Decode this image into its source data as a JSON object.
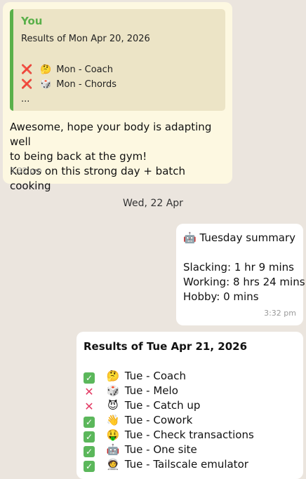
{
  "incoming": {
    "quote": {
      "author": "You",
      "title": "Results of Mon Apr 20, 2026",
      "items": [
        {
          "mark": "❌",
          "emoji": "🤔",
          "text": "Mon - Coach"
        },
        {
          "mark": "❌",
          "emoji": "🎲",
          "text": "Mon - Chords"
        }
      ],
      "more": "..."
    },
    "lines": [
      "Awesome, hope your body is adapting well",
      "to being back at the gym!",
      "Kudos on this strong day + batch cooking"
    ],
    "time": "3:32 pm"
  },
  "date_separator": "Wed, 22 Apr",
  "summary": {
    "emoji": "🤖",
    "title": "Tuesday summary",
    "lines": [
      "Slacking: 1 hr 9 mins",
      "Working: 8 hrs 24 mins",
      "Hobby: 0 mins"
    ],
    "time": "3:32 pm"
  },
  "results": {
    "title": "Results of Tue Apr 21, 2026",
    "items": [
      {
        "mark": "✓",
        "status": "done",
        "emoji": "🤔",
        "text": "Tue - Coach"
      },
      {
        "mark": "✕",
        "status": "missed",
        "emoji": "🎲",
        "text": "Tue - Melo"
      },
      {
        "mark": "✕",
        "status": "missed",
        "emoji": "😈",
        "text": "Tue - Catch up"
      },
      {
        "mark": "✓",
        "status": "done",
        "emoji": "👋",
        "text": "Tue - Cowork"
      },
      {
        "mark": "✓",
        "status": "done",
        "emoji": "🤑",
        "text": "Tue - Check transactions"
      },
      {
        "mark": "✓",
        "status": "done",
        "emoji": "🤖",
        "text": "Tue - One site"
      },
      {
        "mark": "✓",
        "status": "done",
        "emoji": "🧑‍🚀",
        "text": "Tue - Tailscale emulator"
      }
    ]
  },
  "colors": {
    "background": "#ebe5de",
    "incoming_bubble": "#fdf8e1",
    "outgoing_bubble": "#ffffff",
    "quote_accent": "#5ab04a",
    "cross": "#e33a64",
    "check": "#5bb75b"
  }
}
